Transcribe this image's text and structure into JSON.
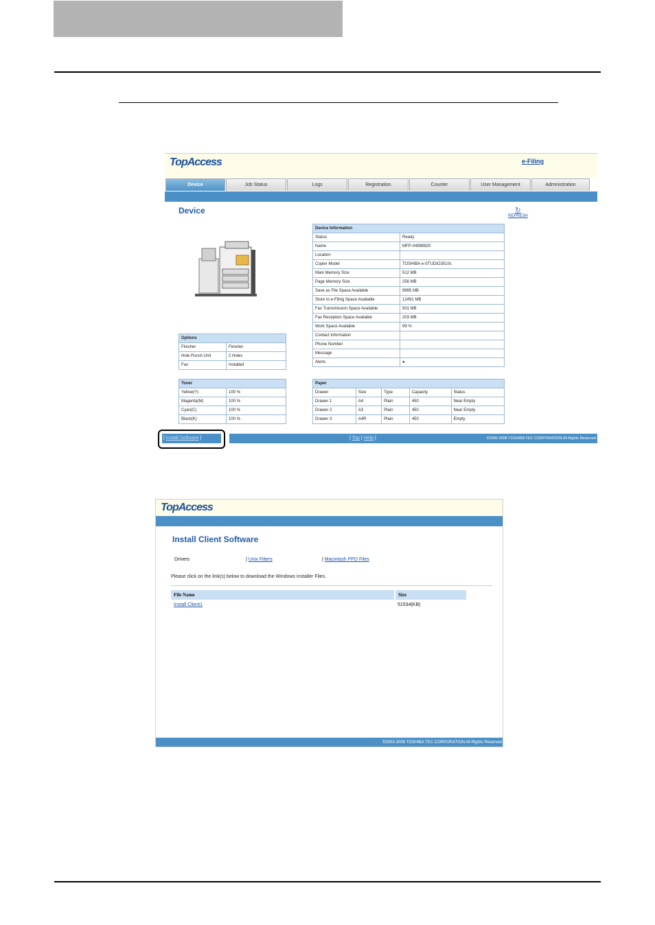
{
  "shot1": {
    "brand": "TopAccess",
    "efiling_link": "e-Filing",
    "tabs": [
      "Device",
      "Job Status",
      "Logs",
      "Registration",
      "Counter",
      "User Management",
      "Administration"
    ],
    "page_title": "Device",
    "refresh_label": "REFRESH",
    "device_info": {
      "caption": "Device Information",
      "rows": [
        [
          "Status",
          "Ready"
        ],
        [
          "Name",
          "MFP-04998820"
        ],
        [
          "Location",
          ""
        ],
        [
          "Copier Model",
          "TOSHIBA e-STUDIO3510c"
        ],
        [
          "Main Memory Size",
          "512 MB"
        ],
        [
          "Page Memory Size",
          "256 MB"
        ],
        [
          "Save as File Space Available",
          "9995 MB"
        ],
        [
          "Store to e-Filing Space Available",
          "12491 MB"
        ],
        [
          "Fax Transmission Space Available",
          "501 MB"
        ],
        [
          "Fax Reception Space Available",
          "203 MB"
        ],
        [
          "Work Space Available",
          "99 %"
        ],
        [
          "Contact Information",
          ""
        ],
        [
          "Phone Number",
          ""
        ],
        [
          "Message",
          ""
        ],
        [
          "Alerts",
          "●"
        ]
      ]
    },
    "options": {
      "caption": "Options",
      "rows": [
        [
          "Finisher",
          "Finisher"
        ],
        [
          "Hole Punch Unit",
          "2 Holes"
        ],
        [
          "Fax",
          "Installed"
        ]
      ]
    },
    "toner": {
      "caption": "Toner",
      "rows": [
        [
          "Yellow(Y)",
          "100 %"
        ],
        [
          "Magenta(M)",
          "100 %"
        ],
        [
          "Cyan(C)",
          "100 %"
        ],
        [
          "Black(K)",
          "100 %"
        ]
      ]
    },
    "paper": {
      "caption": "Paper",
      "headers": [
        "Drawer",
        "Size",
        "Type",
        "Capacity",
        "Status"
      ],
      "rows": [
        [
          "Drawer 1",
          "A4",
          "Plain",
          "450",
          "Near Empty"
        ],
        [
          "Drawer 2",
          "A3",
          "Plain",
          "450",
          "Near Empty"
        ],
        [
          "Drawer 3",
          "A4R",
          "Plain",
          "450",
          "Empty"
        ]
      ]
    },
    "footer": {
      "install_link": "Install Software",
      "top_link": "Top",
      "help_link": "Help",
      "sep": "|",
      "copyright": "©2000-2008 TOSHIBA TEC CORPORATION All Rights Reserved"
    }
  },
  "shot2": {
    "brand": "TopAccess",
    "title": "Install Client Software",
    "nav": {
      "drivers": "Drivers",
      "unix": "Unix Filters",
      "mac": "Macintosh PPD Files",
      "sep": "|"
    },
    "instruction": "Please click on the link(s) below to download the Windows Installer Files.",
    "table": {
      "headers": [
        "File Name",
        "Size"
      ],
      "rows": [
        [
          "Install Client1",
          "51534(KB)"
        ]
      ]
    },
    "copyright": "©2003-2008 TOSHIBA TEC CORPORATION All Rights Reserved"
  }
}
